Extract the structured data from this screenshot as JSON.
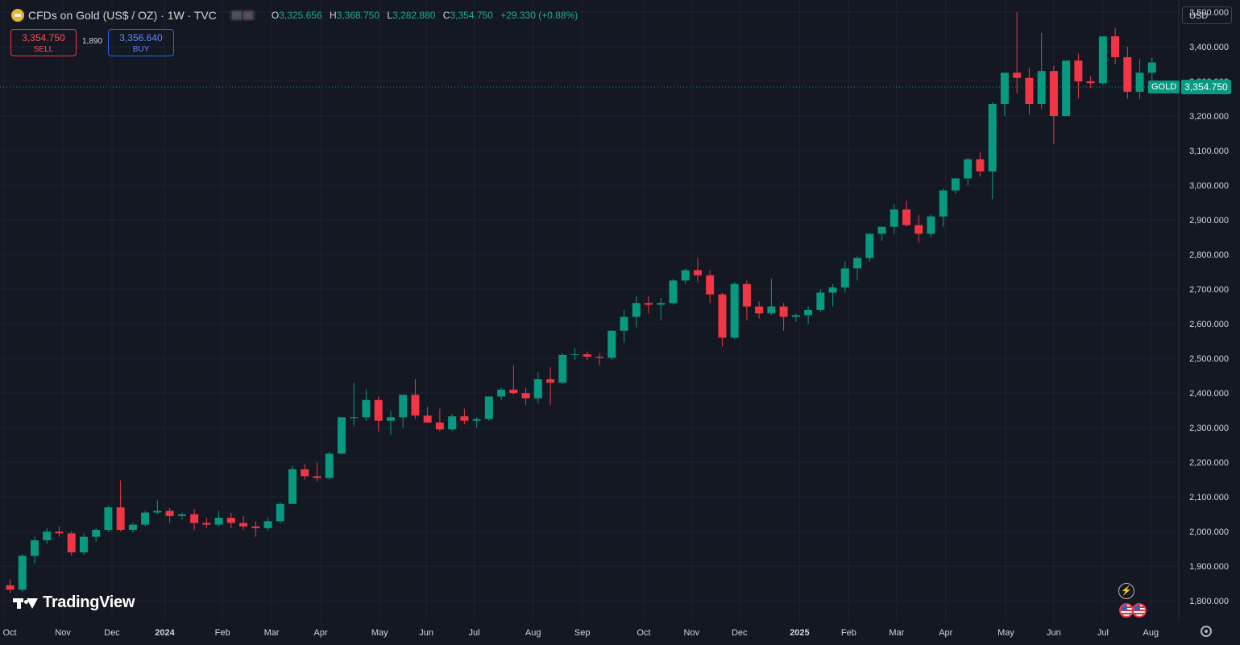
{
  "header": {
    "title": "CFDs on Gold (US$ / OZ) · 1W · TVC",
    "open_key": "O",
    "open": "3,325.656",
    "high_key": "H",
    "high": "3,368.750",
    "low_key": "L",
    "low": "3,282.880",
    "close_key": "C",
    "close": "3,354.750",
    "change": "+29.330 (+0.88%)"
  },
  "trade": {
    "sell_price": "3,354.750",
    "sell_label": "SELL",
    "spread": "1,890",
    "buy_price": "3,356.640",
    "buy_label": "BUY"
  },
  "currency": "USD",
  "symbol_tag": "GOLD",
  "last_price": "3,354.750",
  "branding": "TradingView",
  "colors": {
    "up": "#089981",
    "down": "#f23645",
    "background": "#141823",
    "grid": "#1f2330"
  },
  "chart_data": {
    "type": "candlestick",
    "grid": true,
    "ylim": [
      1740,
      3535
    ],
    "y_ticks": [
      1800,
      1900,
      2000,
      2100,
      2200,
      2300,
      2400,
      2500,
      2600,
      2700,
      2800,
      2900,
      3000,
      3100,
      3200,
      3300,
      3400,
      3500
    ],
    "y_tick_labels": [
      "1,800.000",
      "1,900.000",
      "2,000.000",
      "2,100.000",
      "2,200.000",
      "2,300.000",
      "2,400.000",
      "2,500.000",
      "2,600.000",
      "2,700.000",
      "2,800.000",
      "2,900.000",
      "3,000.000",
      "3,100.000",
      "3,200.000",
      "3,300.000",
      "3,400.000",
      "3,500.000"
    ],
    "x_labels": [
      {
        "label": "Oct",
        "bar": -0.5
      },
      {
        "label": "Nov",
        "bar": 4.3
      },
      {
        "label": "Dec",
        "bar": 8.3
      },
      {
        "label": "2024",
        "bar": 12.6
      },
      {
        "label": "Feb",
        "bar": 17.3
      },
      {
        "label": "Mar",
        "bar": 21.3
      },
      {
        "label": "Apr",
        "bar": 25.3
      },
      {
        "label": "May",
        "bar": 30.1
      },
      {
        "label": "Jun",
        "bar": 33.9
      },
      {
        "label": "Jul",
        "bar": 37.8
      },
      {
        "label": "Aug",
        "bar": 42.6
      },
      {
        "label": "Sep",
        "bar": 46.6
      },
      {
        "label": "Oct",
        "bar": 51.6
      },
      {
        "label": "Nov",
        "bar": 55.5
      },
      {
        "label": "Dec",
        "bar": 59.4
      },
      {
        "label": "2025",
        "bar": 64.3
      },
      {
        "label": "Feb",
        "bar": 68.3
      },
      {
        "label": "Mar",
        "bar": 72.2
      },
      {
        "label": "Apr",
        "bar": 76.2
      },
      {
        "label": "May",
        "bar": 81.1
      },
      {
        "label": "Jun",
        "bar": 85.0
      },
      {
        "label": "Jul",
        "bar": 89.0
      },
      {
        "label": "Aug",
        "bar": 92.9
      }
    ],
    "candles": [
      [
        1845,
        1862,
        1823,
        1832
      ],
      [
        1832,
        1935,
        1825,
        1930
      ],
      [
        1930,
        1985,
        1908,
        1975
      ],
      [
        1975,
        2010,
        1965,
        2000
      ],
      [
        2000,
        2015,
        1985,
        1995
      ],
      [
        1995,
        2000,
        1930,
        1940
      ],
      [
        1940,
        1995,
        1932,
        1985
      ],
      [
        1985,
        2010,
        1970,
        2005
      ],
      [
        2005,
        2075,
        2000,
        2070
      ],
      [
        2070,
        2148,
        2000,
        2005
      ],
      [
        2005,
        2025,
        1998,
        2020
      ],
      [
        2020,
        2060,
        2015,
        2055
      ],
      [
        2055,
        2090,
        2050,
        2060
      ],
      [
        2060,
        2068,
        2025,
        2045
      ],
      [
        2045,
        2055,
        2035,
        2050
      ],
      [
        2050,
        2065,
        2005,
        2025
      ],
      [
        2025,
        2040,
        2010,
        2020
      ],
      [
        2020,
        2060,
        2015,
        2040
      ],
      [
        2040,
        2055,
        2010,
        2025
      ],
      [
        2025,
        2045,
        2005,
        2015
      ],
      [
        2015,
        2030,
        1985,
        2010
      ],
      [
        2010,
        2040,
        2003,
        2030
      ],
      [
        2030,
        2085,
        2025,
        2080
      ],
      [
        2080,
        2190,
        2080,
        2180
      ],
      [
        2180,
        2195,
        2150,
        2160
      ],
      [
        2160,
        2200,
        2145,
        2155
      ],
      [
        2155,
        2230,
        2150,
        2225
      ],
      [
        2225,
        2330,
        2225,
        2330
      ],
      [
        2330,
        2430,
        2305,
        2330
      ],
      [
        2330,
        2410,
        2320,
        2380
      ],
      [
        2380,
        2390,
        2290,
        2320
      ],
      [
        2320,
        2350,
        2280,
        2330
      ],
      [
        2330,
        2380,
        2300,
        2395
      ],
      [
        2395,
        2440,
        2325,
        2335
      ],
      [
        2335,
        2360,
        2320,
        2315
      ],
      [
        2315,
        2355,
        2290,
        2295
      ],
      [
        2295,
        2340,
        2290,
        2333
      ],
      [
        2333,
        2355,
        2310,
        2320
      ],
      [
        2320,
        2330,
        2300,
        2325
      ],
      [
        2325,
        2390,
        2320,
        2390
      ],
      [
        2390,
        2415,
        2380,
        2410
      ],
      [
        2410,
        2480,
        2395,
        2400
      ],
      [
        2400,
        2415,
        2365,
        2385
      ],
      [
        2385,
        2460,
        2370,
        2440
      ],
      [
        2440,
        2475,
        2365,
        2430
      ],
      [
        2430,
        2515,
        2425,
        2510
      ],
      [
        2510,
        2530,
        2495,
        2512
      ],
      [
        2512,
        2520,
        2495,
        2505
      ],
      [
        2505,
        2515,
        2480,
        2502
      ],
      [
        2502,
        2580,
        2495,
        2580
      ],
      [
        2580,
        2640,
        2545,
        2620
      ],
      [
        2620,
        2680,
        2590,
        2660
      ],
      [
        2660,
        2680,
        2630,
        2655
      ],
      [
        2655,
        2675,
        2610,
        2660
      ],
      [
        2660,
        2730,
        2655,
        2725
      ],
      [
        2725,
        2760,
        2715,
        2755
      ],
      [
        2755,
        2790,
        2720,
        2740
      ],
      [
        2740,
        2755,
        2660,
        2685
      ],
      [
        2685,
        2690,
        2535,
        2560
      ],
      [
        2560,
        2720,
        2555,
        2715
      ],
      [
        2715,
        2725,
        2610,
        2650
      ],
      [
        2650,
        2665,
        2615,
        2630
      ],
      [
        2630,
        2730,
        2625,
        2650
      ],
      [
        2650,
        2660,
        2580,
        2620
      ],
      [
        2620,
        2630,
        2605,
        2625
      ],
      [
        2625,
        2650,
        2600,
        2640
      ],
      [
        2640,
        2700,
        2635,
        2690
      ],
      [
        2690,
        2715,
        2650,
        2705
      ],
      [
        2705,
        2780,
        2690,
        2760
      ],
      [
        2760,
        2795,
        2725,
        2790
      ],
      [
        2790,
        2860,
        2780,
        2860
      ],
      [
        2860,
        2880,
        2840,
        2880
      ],
      [
        2880,
        2945,
        2860,
        2930
      ],
      [
        2930,
        2955,
        2880,
        2885
      ],
      [
        2885,
        2915,
        2835,
        2860
      ],
      [
        2860,
        2915,
        2850,
        2910
      ],
      [
        2910,
        2990,
        2880,
        2985
      ],
      [
        2985,
        3020,
        2975,
        3020
      ],
      [
        3020,
        3080,
        3000,
        3075
      ],
      [
        3075,
        3095,
        3025,
        3040
      ],
      [
        3040,
        3240,
        2960,
        3235
      ],
      [
        3235,
        3325,
        3200,
        3325
      ],
      [
        3325,
        3500,
        3265,
        3310
      ],
      [
        3310,
        3340,
        3205,
        3235
      ],
      [
        3235,
        3440,
        3220,
        3330
      ],
      [
        3330,
        3345,
        3120,
        3200
      ],
      [
        3200,
        3360,
        3200,
        3360
      ],
      [
        3360,
        3380,
        3250,
        3300
      ],
      [
        3300,
        3315,
        3280,
        3295
      ],
      [
        3295,
        3395,
        3290,
        3430
      ],
      [
        3430,
        3455,
        3350,
        3370
      ],
      [
        3370,
        3400,
        3250,
        3270
      ],
      [
        3270,
        3365,
        3248,
        3325
      ],
      [
        3325,
        3368.75,
        3282.88,
        3354.75
      ]
    ]
  }
}
